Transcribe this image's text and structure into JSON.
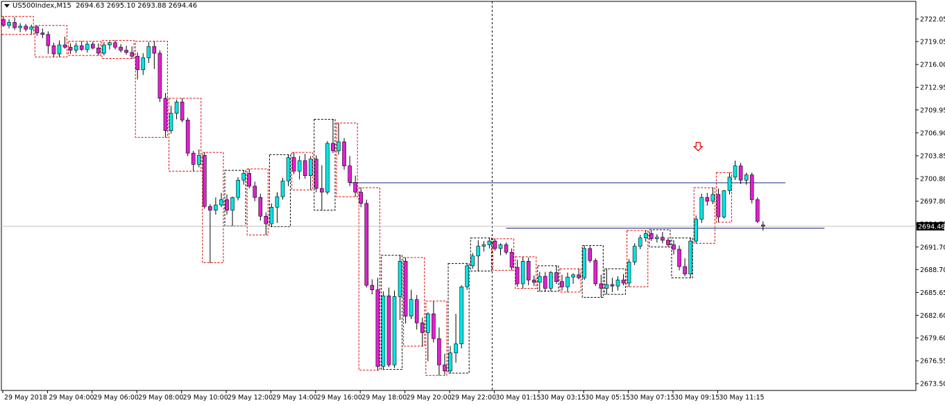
{
  "header": {
    "symbol": "US500Index,M15",
    "ohlc": "2694.63 2695.10 2693.88 2694.46"
  },
  "colors": {
    "bull": "#00e5e5",
    "bear": "#e020d0",
    "wick": "#000000",
    "box_bull": "#000000",
    "box_bear": "#e00000",
    "level_line": "#1a237e",
    "current_line": "#c0c0c0",
    "arrow": "#e00000"
  },
  "chart_data": {
    "type": "candlestick",
    "timeframe": "M15",
    "current_price": 2694.46,
    "current_price_label": "2694.46",
    "ylim": [
      2672.6,
      2724.4
    ],
    "y_ticks": [
      "2722.05",
      "2719.05",
      "2716.00",
      "2712.95",
      "2709.95",
      "2706.90",
      "2703.85",
      "2700.80",
      "2697.80",
      "2694.75",
      "2691.70",
      "2688.70",
      "2685.65",
      "2682.60",
      "2679.60",
      "2676.55",
      "2673.50"
    ],
    "x_ticks": [
      {
        "label": "29 May 2018",
        "index": 0
      },
      {
        "label": "29 May 04:00",
        "index": 8
      },
      {
        "label": "29 May 06:00",
        "index": 16
      },
      {
        "label": "29 May 08:00",
        "index": 24
      },
      {
        "label": "29 May 10:00",
        "index": 32
      },
      {
        "label": "29 May 12:00",
        "index": 40
      },
      {
        "label": "29 May 14:00",
        "index": 48
      },
      {
        "label": "29 May 16:00",
        "index": 56
      },
      {
        "label": "29 May 18:00",
        "index": 64
      },
      {
        "label": "29 May 20:00",
        "index": 72
      },
      {
        "label": "29 May 22:00",
        "index": 80
      },
      {
        "label": "30 May 01:15",
        "index": 88
      },
      {
        "label": "30 May 03:15",
        "index": 96
      },
      {
        "label": "30 May 05:15",
        "index": 104
      },
      {
        "label": "30 May 07:15",
        "index": 112
      },
      {
        "label": "30 May 09:15",
        "index": 120
      },
      {
        "label": "30 May 11:15",
        "index": 128
      }
    ],
    "candles": [
      [
        2722.0,
        2722.4,
        2721.0,
        2721.2
      ],
      [
        2721.2,
        2722.0,
        2720.8,
        2721.6
      ],
      [
        2721.6,
        2722.3,
        2720.6,
        2720.9
      ],
      [
        2720.9,
        2721.5,
        2720.3,
        2721.1
      ],
      [
        2721.1,
        2721.4,
        2720.4,
        2720.7
      ],
      [
        2720.7,
        2721.3,
        2720.0,
        2721.0
      ],
      [
        2721.0,
        2721.2,
        2719.8,
        2720.2
      ],
      [
        2720.2,
        2720.8,
        2719.5,
        2720.0
      ],
      [
        2720.0,
        2720.4,
        2717.4,
        2718.5
      ],
      [
        2718.5,
        2718.9,
        2717.0,
        2717.4
      ],
      [
        2717.4,
        2719.2,
        2717.0,
        2718.6
      ],
      [
        2718.6,
        2719.7,
        2718.1,
        2718.3
      ],
      [
        2718.3,
        2718.8,
        2717.4,
        2717.9
      ],
      [
        2717.9,
        2718.9,
        2717.5,
        2718.5
      ],
      [
        2718.5,
        2719.1,
        2717.8,
        2718.0
      ],
      [
        2718.0,
        2719.0,
        2717.6,
        2718.7
      ],
      [
        2718.7,
        2719.0,
        2718.0,
        2718.2
      ],
      [
        2718.2,
        2718.8,
        2717.2,
        2717.5
      ],
      [
        2717.5,
        2719.0,
        2717.2,
        2718.6
      ],
      [
        2718.6,
        2719.1,
        2718.0,
        2718.9
      ],
      [
        2718.9,
        2719.2,
        2718.0,
        2718.3
      ],
      [
        2718.3,
        2718.7,
        2717.6,
        2717.9
      ],
      [
        2717.9,
        2718.5,
        2717.3,
        2717.6
      ],
      [
        2717.6,
        2718.4,
        2716.8,
        2717.1
      ],
      [
        2717.1,
        2717.6,
        2714.0,
        2715.3
      ],
      [
        2715.3,
        2717.5,
        2714.6,
        2716.9
      ],
      [
        2716.9,
        2719.0,
        2716.2,
        2718.4
      ],
      [
        2718.4,
        2719.1,
        2715.4,
        2717.5
      ],
      [
        2717.5,
        2717.9,
        2711.0,
        2711.5
      ],
      [
        2711.5,
        2712.2,
        2706.3,
        2707.2
      ],
      [
        2707.2,
        2710.5,
        2706.8,
        2709.5
      ],
      [
        2709.5,
        2711.3,
        2708.7,
        2711.0
      ],
      [
        2711.0,
        2711.5,
        2708.3,
        2708.6
      ],
      [
        2708.6,
        2708.9,
        2703.8,
        2704.2
      ],
      [
        2704.2,
        2704.5,
        2701.8,
        2702.7
      ],
      [
        2702.7,
        2704.7,
        2702.3,
        2703.9
      ],
      [
        2703.9,
        2704.3,
        2696.8,
        2697.1
      ],
      [
        2697.1,
        2697.4,
        2689.6,
        2696.6
      ],
      [
        2696.6,
        2698.3,
        2696.0,
        2697.3
      ],
      [
        2697.3,
        2698.9,
        2697.0,
        2698.0
      ],
      [
        2698.0,
        2698.7,
        2696.0,
        2696.6
      ],
      [
        2696.6,
        2698.4,
        2694.5,
        2698.3
      ],
      [
        2698.3,
        2701.0,
        2697.9,
        2700.6
      ],
      [
        2700.6,
        2701.9,
        2700.0,
        2701.5
      ],
      [
        2701.5,
        2702.1,
        2699.5,
        2699.8
      ],
      [
        2699.8,
        2700.4,
        2697.8,
        2698.3
      ],
      [
        2698.3,
        2698.8,
        2695.2,
        2695.8
      ],
      [
        2695.8,
        2696.3,
        2693.3,
        2694.8
      ],
      [
        2694.8,
        2697.5,
        2694.4,
        2697.0
      ],
      [
        2697.0,
        2699.0,
        2694.9,
        2698.4
      ],
      [
        2698.4,
        2700.9,
        2698.0,
        2700.5
      ],
      [
        2700.5,
        2704.0,
        2699.8,
        2703.6
      ],
      [
        2703.6,
        2704.3,
        2701.4,
        2701.8
      ],
      [
        2701.8,
        2703.8,
        2700.7,
        2703.2
      ],
      [
        2703.2,
        2704.1,
        2700.8,
        2701.2
      ],
      [
        2701.2,
        2703.8,
        2699.3,
        2703.4
      ],
      [
        2703.4,
        2703.9,
        2699.0,
        2699.5
      ],
      [
        2699.5,
        2702.6,
        2696.6,
        2699.0
      ],
      [
        2699.0,
        2705.8,
        2698.7,
        2705.5
      ],
      [
        2705.5,
        2708.7,
        2704.2,
        2704.5
      ],
      [
        2704.5,
        2708.2,
        2704.0,
        2705.7
      ],
      [
        2705.7,
        2706.2,
        2702.0,
        2702.5
      ],
      [
        2702.5,
        2703.8,
        2699.8,
        2700.3
      ],
      [
        2700.3,
        2701.2,
        2698.4,
        2699.0
      ],
      [
        2699.0,
        2699.6,
        2697.0,
        2697.5
      ],
      [
        2697.5,
        2698.0,
        2686.3,
        2686.6
      ],
      [
        2686.6,
        2687.4,
        2685.4,
        2686.0
      ],
      [
        2686.0,
        2687.6,
        2675.3,
        2675.8
      ],
      [
        2675.8,
        2685.8,
        2675.4,
        2685.2
      ],
      [
        2685.2,
        2686.3,
        2675.7,
        2676.0
      ],
      [
        2676.0,
        2685.9,
        2675.6,
        2685.1
      ],
      [
        2685.1,
        2690.6,
        2682.0,
        2689.8
      ],
      [
        2689.8,
        2690.3,
        2681.5,
        2682.5
      ],
      [
        2682.5,
        2686.0,
        2682.1,
        2684.7
      ],
      [
        2684.7,
        2685.3,
        2680.7,
        2681.6
      ],
      [
        2681.6,
        2682.3,
        2678.5,
        2680.3
      ],
      [
        2680.3,
        2683.0,
        2676.5,
        2682.8
      ],
      [
        2682.8,
        2684.5,
        2679.0,
        2679.5
      ],
      [
        2679.5,
        2681.0,
        2674.6,
        2676.0
      ],
      [
        2676.0,
        2677.5,
        2674.7,
        2675.2
      ],
      [
        2675.2,
        2678.5,
        2674.9,
        2677.6
      ],
      [
        2677.6,
        2682.8,
        2676.3,
        2678.8
      ],
      [
        2678.8,
        2686.6,
        2678.2,
        2686.4
      ],
      [
        2686.4,
        2689.5,
        2686.0,
        2689.2
      ],
      [
        2689.2,
        2690.9,
        2688.8,
        2690.5
      ],
      [
        2690.5,
        2692.6,
        2688.5,
        2691.8
      ],
      [
        2691.8,
        2692.5,
        2691.1,
        2692.0
      ],
      [
        2692.0,
        2692.9,
        2691.5,
        2692.5
      ],
      [
        2692.5,
        2692.8,
        2691.2,
        2691.5
      ],
      [
        2691.5,
        2692.2,
        2690.6,
        2692.0
      ],
      [
        2692.0,
        2692.3,
        2690.7,
        2691.0
      ],
      [
        2691.0,
        2691.5,
        2688.6,
        2689.0
      ],
      [
        2689.0,
        2690.0,
        2686.4,
        2686.8
      ],
      [
        2686.8,
        2690.4,
        2686.2,
        2689.8
      ],
      [
        2689.8,
        2690.3,
        2686.6,
        2687.3
      ],
      [
        2687.3,
        2687.9,
        2686.5,
        2687.0
      ],
      [
        2687.0,
        2688.4,
        2685.8,
        2687.8
      ],
      [
        2687.8,
        2688.4,
        2685.8,
        2686.2
      ],
      [
        2686.2,
        2688.5,
        2685.8,
        2688.3
      ],
      [
        2688.3,
        2689.2,
        2686.8,
        2687.1
      ],
      [
        2687.1,
        2688.0,
        2685.9,
        2686.4
      ],
      [
        2686.4,
        2688.3,
        2685.7,
        2687.7
      ],
      [
        2687.7,
        2688.2,
        2686.8,
        2688.0
      ],
      [
        2688.0,
        2688.8,
        2687.4,
        2687.6
      ],
      [
        2687.6,
        2691.9,
        2687.3,
        2691.5
      ],
      [
        2691.5,
        2691.8,
        2689.6,
        2689.9
      ],
      [
        2689.9,
        2690.2,
        2686.5,
        2686.8
      ],
      [
        2686.8,
        2688.0,
        2685.0,
        2686.2
      ],
      [
        2686.2,
        2688.8,
        2685.4,
        2686.7
      ],
      [
        2686.7,
        2687.6,
        2685.7,
        2686.5
      ],
      [
        2686.5,
        2687.8,
        2685.9,
        2687.3
      ],
      [
        2687.3,
        2688.1,
        2686.6,
        2686.9
      ],
      [
        2686.9,
        2690.1,
        2686.4,
        2689.7
      ],
      [
        2689.7,
        2692.2,
        2689.3,
        2691.8
      ],
      [
        2691.8,
        2693.3,
        2691.4,
        2692.9
      ],
      [
        2692.9,
        2693.9,
        2692.4,
        2693.5
      ],
      [
        2693.5,
        2694.0,
        2692.5,
        2692.8
      ],
      [
        2692.8,
        2693.4,
        2692.3,
        2693.0
      ],
      [
        2693.0,
        2693.7,
        2692.2,
        2692.6
      ],
      [
        2692.6,
        2693.0,
        2691.7,
        2692.0
      ],
      [
        2692.0,
        2692.6,
        2690.7,
        2691.4
      ],
      [
        2691.4,
        2691.9,
        2688.6,
        2689.1
      ],
      [
        2689.1,
        2690.2,
        2687.8,
        2688.1
      ],
      [
        2688.1,
        2692.9,
        2687.6,
        2692.5
      ],
      [
        2692.5,
        2695.9,
        2692.2,
        2695.4
      ],
      [
        2695.4,
        2698.8,
        2694.9,
        2698.3
      ],
      [
        2698.3,
        2698.9,
        2697.2,
        2697.8
      ],
      [
        2697.8,
        2699.6,
        2697.4,
        2698.7
      ],
      [
        2698.7,
        2699.5,
        2695.0,
        2695.7
      ],
      [
        2695.7,
        2699.3,
        2695.5,
        2699.2
      ],
      [
        2699.2,
        2701.6,
        2698.7,
        2701.0
      ],
      [
        2701.0,
        2703.2,
        2700.6,
        2702.5
      ],
      [
        2702.5,
        2702.9,
        2700.1,
        2700.6
      ],
      [
        2700.6,
        2701.6,
        2700.0,
        2701.3
      ],
      [
        2701.3,
        2701.6,
        2697.5,
        2698.0
      ],
      [
        2698.0,
        2698.3,
        2694.9,
        2695.1
      ],
      [
        2694.63,
        2695.1,
        2693.88,
        2694.46
      ]
    ],
    "boxes": [
      {
        "from": 0,
        "to": 5,
        "dir": "down"
      },
      {
        "from": 6,
        "to": 11,
        "dir": "down"
      },
      {
        "from": 12,
        "to": 17,
        "dir": "down"
      },
      {
        "from": 18,
        "to": 23,
        "dir": "down"
      },
      {
        "from": 24,
        "to": 29,
        "dir": "down"
      },
      {
        "from": 30,
        "to": 35,
        "dir": "down"
      },
      {
        "from": 36,
        "to": 39,
        "dir": "down"
      },
      {
        "from": 40,
        "to": 43,
        "dir": "up"
      },
      {
        "from": 44,
        "to": 47,
        "dir": "down"
      },
      {
        "from": 48,
        "to": 51,
        "dir": "up"
      },
      {
        "from": 52,
        "to": 55,
        "dir": "down"
      },
      {
        "from": 56,
        "to": 59,
        "dir": "up"
      },
      {
        "from": 60,
        "to": 63,
        "dir": "down"
      },
      {
        "from": 64,
        "to": 67,
        "dir": "down"
      },
      {
        "from": 68,
        "to": 71,
        "dir": "up"
      },
      {
        "from": 72,
        "to": 75,
        "dir": "down"
      },
      {
        "from": 76,
        "to": 79,
        "dir": "down"
      },
      {
        "from": 80,
        "to": 83,
        "dir": "up"
      },
      {
        "from": 84,
        "to": 87,
        "dir": "up"
      },
      {
        "from": 88,
        "to": 91,
        "dir": "down"
      },
      {
        "from": 92,
        "to": 95,
        "dir": "down"
      },
      {
        "from": 96,
        "to": 99,
        "dir": "up"
      },
      {
        "from": 100,
        "to": 103,
        "dir": "down"
      },
      {
        "from": 104,
        "to": 107,
        "dir": "up"
      },
      {
        "from": 108,
        "to": 111,
        "dir": "up"
      },
      {
        "from": 112,
        "to": 115,
        "dir": "down"
      },
      {
        "from": 116,
        "to": 119,
        "dir": "up"
      },
      {
        "from": 120,
        "to": 123,
        "dir": "up"
      },
      {
        "from": 124,
        "to": 127,
        "dir": "down"
      },
      {
        "from": 128,
        "to": 130,
        "dir": "down"
      }
    ],
    "levels": [
      {
        "price": 2700.25,
        "from": 62,
        "to": 140
      },
      {
        "price": 2694.2,
        "from": 90,
        "to": 147
      }
    ],
    "vertical_separator_index": 87,
    "signal_arrow": {
      "index": 125,
      "price": 2704.7,
      "direction": "down"
    }
  }
}
